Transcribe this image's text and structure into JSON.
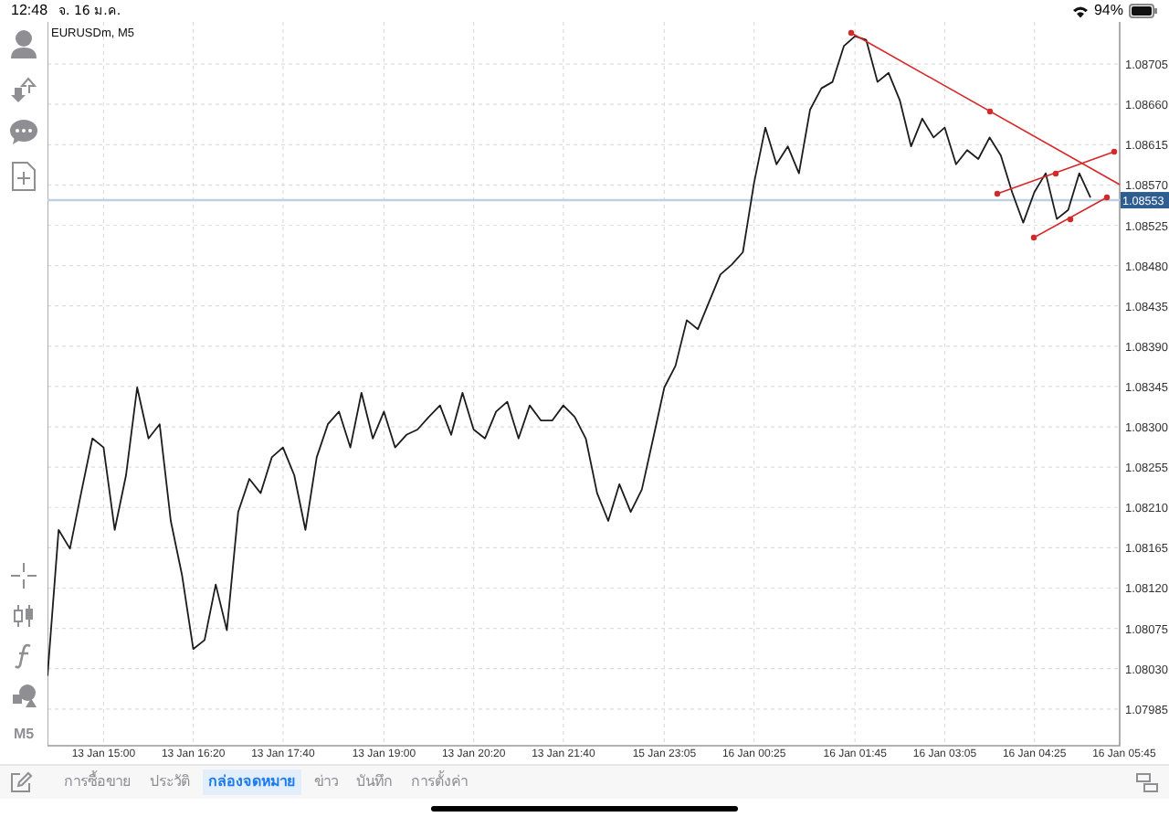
{
  "status_bar": {
    "time": "12:48",
    "date": "จ. 16 ม.ค.",
    "battery": "94%"
  },
  "chart": {
    "title": "EURUSDm, M5",
    "timeframe": "M5",
    "chart_data": {
      "type": "line",
      "grid": true,
      "ylim": [
        1.07944,
        1.08752
      ],
      "yticks": [
        {
          "value": 1.08705,
          "label": "1.08705"
        },
        {
          "value": 1.0866,
          "label": "1.08660"
        },
        {
          "value": 1.08615,
          "label": "1.08615"
        },
        {
          "value": 1.0857,
          "label": "1.08570"
        },
        {
          "value": 1.08525,
          "label": "1.08525"
        },
        {
          "value": 1.0848,
          "label": "1.08480"
        },
        {
          "value": 1.08435,
          "label": "1.08435"
        },
        {
          "value": 1.0839,
          "label": "1.08390"
        },
        {
          "value": 1.08345,
          "label": "1.08345"
        },
        {
          "value": 1.083,
          "label": "1.08300"
        },
        {
          "value": 1.08255,
          "label": "1.08255"
        },
        {
          "value": 1.0821,
          "label": "1.08210"
        },
        {
          "value": 1.08165,
          "label": "1.08165"
        },
        {
          "value": 1.0812,
          "label": "1.08120"
        },
        {
          "value": 1.08075,
          "label": "1.08075"
        },
        {
          "value": 1.0803,
          "label": "1.08030"
        },
        {
          "value": 1.07985,
          "label": "1.07985"
        }
      ],
      "categories": [
        null,
        null,
        null,
        null,
        null,
        "13 Jan 15:00",
        null,
        null,
        null,
        null,
        null,
        null,
        null,
        "13 Jan 16:20",
        null,
        null,
        null,
        null,
        null,
        null,
        null,
        "13 Jan 17:40",
        null,
        null,
        null,
        null,
        null,
        null,
        null,
        null,
        "13 Jan 19:00",
        null,
        null,
        null,
        null,
        null,
        null,
        null,
        "13 Jan 20:20",
        null,
        null,
        null,
        null,
        null,
        null,
        null,
        "13 Jan 21:40",
        null,
        null,
        null,
        null,
        null,
        null,
        null,
        null,
        "15 Jan 23:05",
        null,
        null,
        null,
        null,
        null,
        null,
        null,
        "16 Jan 00:25",
        null,
        null,
        null,
        null,
        null,
        null,
        null,
        null,
        "16 Jan 01:45",
        null,
        null,
        null,
        null,
        null,
        null,
        null,
        "16 Jan 03:05",
        null,
        null,
        null,
        null,
        null,
        null,
        null,
        "16 Jan 04:25",
        null,
        null,
        null,
        null,
        null,
        null,
        null,
        "16 Jan 05:45"
      ],
      "series": [
        {
          "color": "#1c1c1c",
          "values": [
            1.08022,
            1.08185,
            1.08164,
            1.08226,
            1.08287,
            1.08277,
            1.08185,
            1.08246,
            1.08344,
            1.08287,
            1.08303,
            1.08195,
            1.08134,
            1.08052,
            1.08062,
            1.08124,
            1.08073,
            1.08205,
            1.08242,
            1.08226,
            1.08266,
            1.08277,
            1.08246,
            1.08185,
            1.08266,
            1.08303,
            1.08317,
            1.08277,
            1.08338,
            1.08287,
            1.08317,
            1.08277,
            1.08291,
            1.08297,
            1.08311,
            1.08324,
            1.08291,
            1.08338,
            1.08297,
            1.08287,
            1.08317,
            1.08328,
            1.08287,
            1.08324,
            1.08307,
            1.08307,
            1.08324,
            1.08311,
            1.08287,
            1.08226,
            1.08195,
            1.08236,
            1.08205,
            1.0823,
            1.08287,
            1.08344,
            1.08368,
            1.08419,
            1.08409,
            1.0844,
            1.0847,
            1.08481,
            1.08495,
            1.08572,
            1.08634,
            1.08593,
            1.08613,
            1.08583,
            1.08654,
            1.08678,
            1.08685,
            1.08725,
            1.08736,
            1.08732,
            1.08685,
            1.08695,
            1.08664,
            1.08613,
            1.08644,
            1.08623,
            1.08634,
            1.08593,
            1.08609,
            1.08599,
            1.08623,
            1.08603,
            1.08562,
            1.08528,
            1.08562,
            1.08583,
            1.08532,
            1.08542,
            1.08583,
            1.08556,
            null,
            null,
            null
          ]
        }
      ],
      "ref_lines": [
        {
          "axis": "y",
          "value": 1.08553,
          "label": "1.08553",
          "color": "#bfd0e0"
        }
      ]
    }
  },
  "tabs": [
    {
      "label": "การซื้อขาย",
      "selected": false
    },
    {
      "label": "ประวัติ",
      "selected": false
    },
    {
      "label": "กล่องจดหมาย",
      "selected": true
    },
    {
      "label": "ข่าว",
      "selected": false
    },
    {
      "label": "บันทึก",
      "selected": false
    },
    {
      "label": "การตั้งค่า",
      "selected": false
    }
  ]
}
